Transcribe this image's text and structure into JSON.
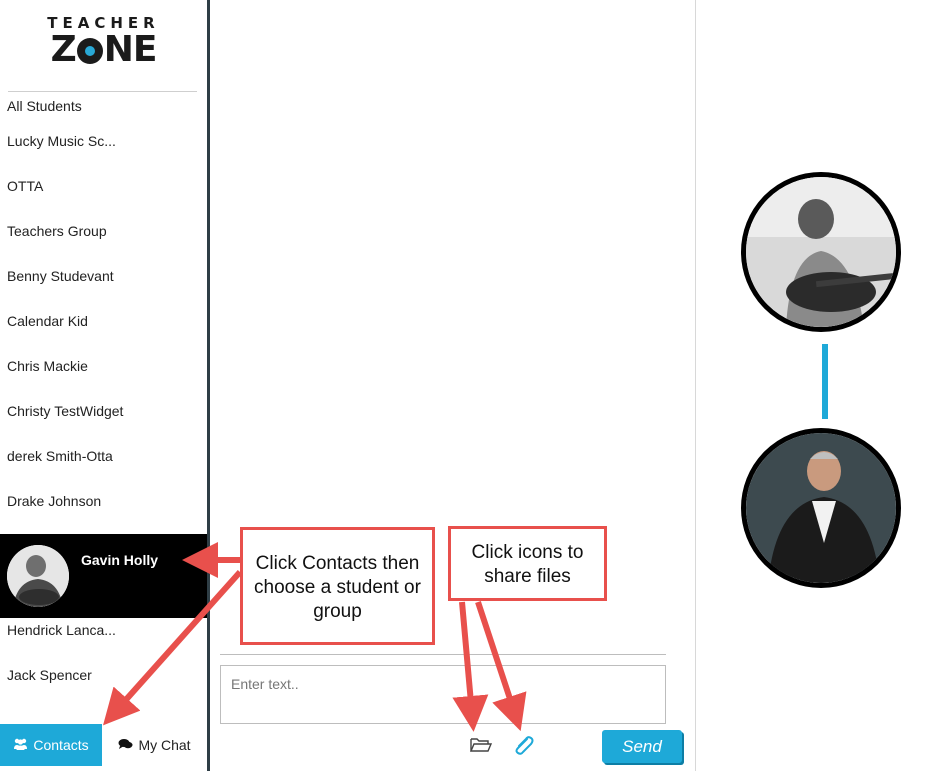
{
  "logo": {
    "top": "TEACHER",
    "main_left": "Z",
    "main_right": "NE"
  },
  "contacts": [
    {
      "name": "All Students"
    },
    {
      "name": "Lucky Music Sc..."
    },
    {
      "name": "OTTA"
    },
    {
      "name": "Teachers Group"
    },
    {
      "name": "Benny Studevant"
    },
    {
      "name": "Calendar Kid"
    },
    {
      "name": "Chris Mackie"
    },
    {
      "name": "Christy TestWidget"
    },
    {
      "name": "derek Smith-Otta"
    },
    {
      "name": "Drake Johnson"
    },
    {
      "name": "Gavin Holly",
      "active": true
    },
    {
      "name": "Hendrick Lanca..."
    },
    {
      "name": "Jack Spencer"
    }
  ],
  "tabs": {
    "contacts": "Contacts",
    "my_chat": "My Chat"
  },
  "composer": {
    "placeholder": "Enter text..",
    "send_label": "Send"
  },
  "callouts": {
    "contacts": "Click Contacts then choose a student or group",
    "share": "Click icons to share files"
  },
  "colors": {
    "accent": "#1ea9d8",
    "callout": "#e8504c",
    "sidebar_active": "#000000"
  },
  "icons": {
    "users": "users-icon",
    "chat": "chat-bubbles-icon",
    "folder": "folder-open-icon",
    "attach": "paperclip-icon"
  }
}
